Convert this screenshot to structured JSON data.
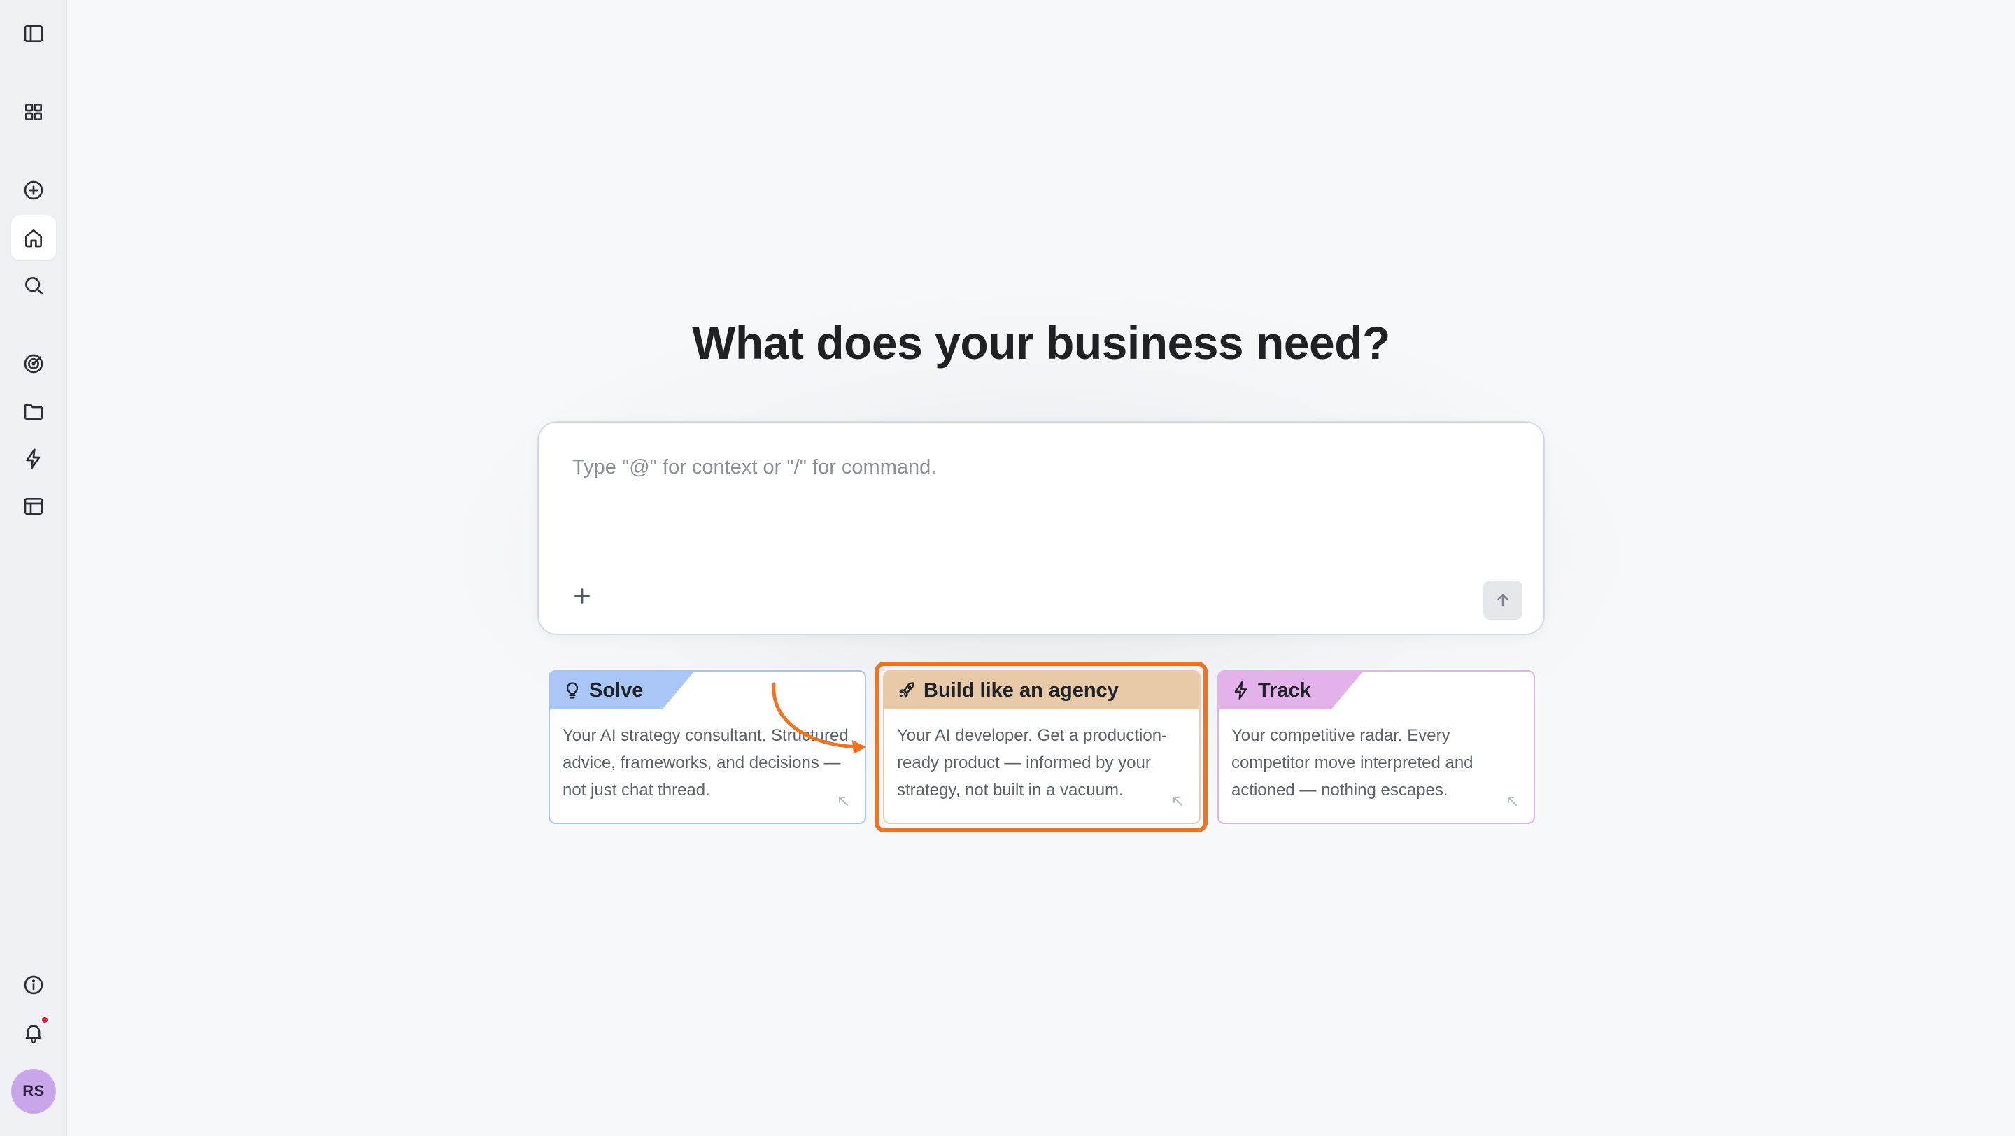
{
  "sidebar": {
    "items": [
      {
        "name": "toggle-sidebar",
        "icon": "sidebar-icon"
      },
      {
        "name": "apps",
        "icon": "grid-icon"
      },
      {
        "name": "new",
        "icon": "plus-circle-icon"
      },
      {
        "name": "home",
        "icon": "home-icon",
        "active": true
      },
      {
        "name": "search",
        "icon": "search-icon"
      },
      {
        "name": "goals",
        "icon": "target-icon"
      },
      {
        "name": "files",
        "icon": "folder-icon"
      },
      {
        "name": "automations",
        "icon": "bolt-icon"
      },
      {
        "name": "layout",
        "icon": "layout-icon"
      },
      {
        "name": "info",
        "icon": "info-icon"
      },
      {
        "name": "notifications",
        "icon": "bell-icon",
        "has_dot": true
      }
    ],
    "avatar_initials": "RS",
    "avatar_color": "#c9a6ea"
  },
  "main": {
    "title": "What does your business need?",
    "composer": {
      "placeholder": "Type \"@\" for context or \"/\" for command.",
      "value": ""
    },
    "cards": [
      {
        "label": "Solve",
        "icon": "lightbulb-icon",
        "description": "Your AI strategy consultant. Structured advice, frameworks, and decisions — not just chat thread.",
        "accent": "#a9c6f7"
      },
      {
        "label": "Build like an agency",
        "icon": "rocket-icon",
        "description": "Your AI developer. Get a production-ready product — informed by your strategy, not built in a vacuum.",
        "accent": "#e8c9a8",
        "highlighted": true
      },
      {
        "label": "Track",
        "icon": "bolt-icon",
        "description": "Your competitive radar. Every competitor move interpreted and actioned — nothing escapes.",
        "accent": "#e3b2ea"
      }
    ],
    "highlight_color": "#f07320"
  }
}
